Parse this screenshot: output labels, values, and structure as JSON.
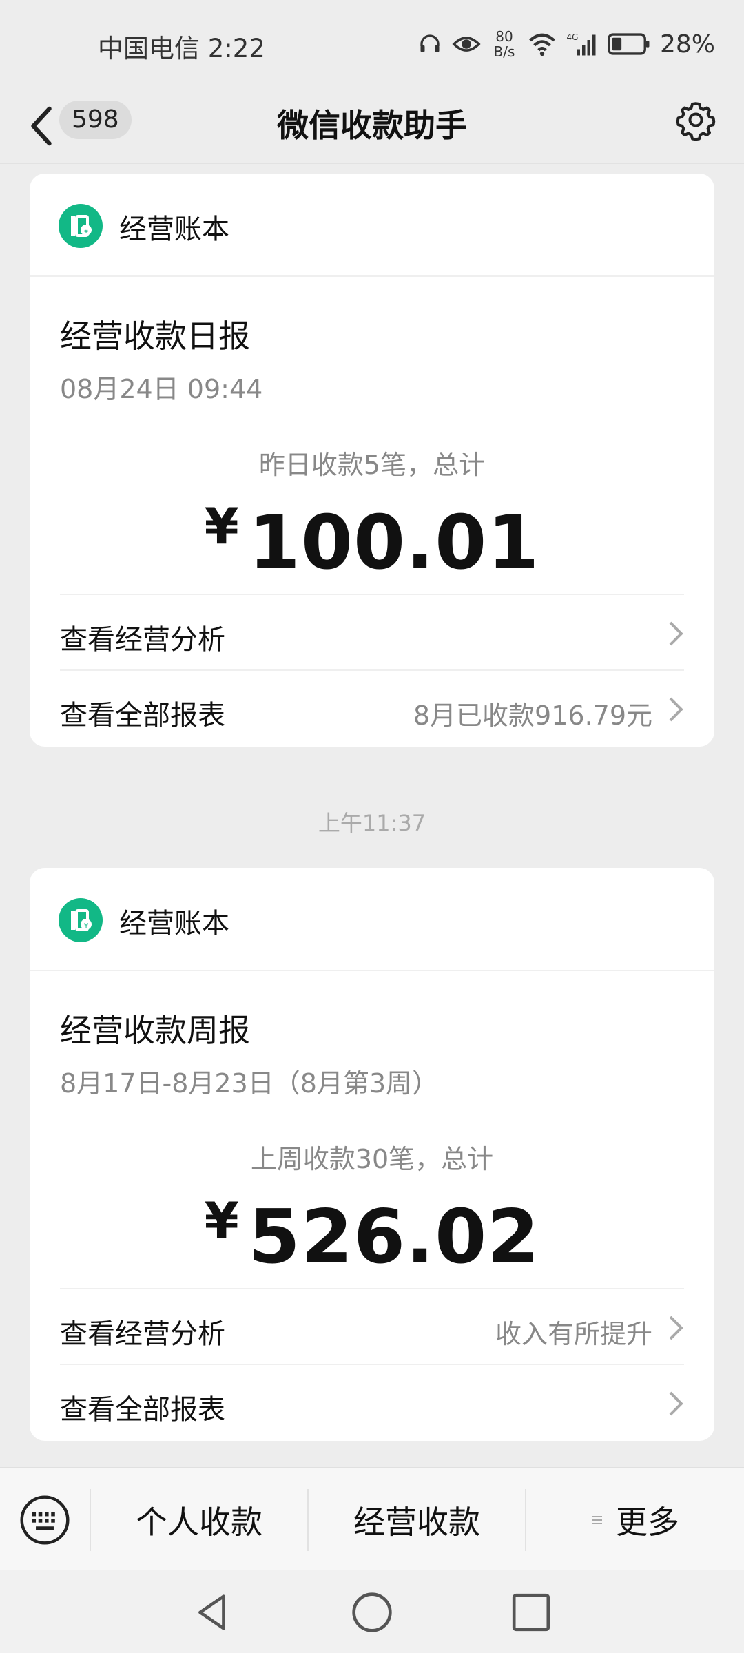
{
  "status_bar": {
    "carrier_time": "中国电信 2:22",
    "speed_value": "80",
    "speed_unit": "B/s",
    "network": "4G",
    "battery_percent": "28%"
  },
  "header": {
    "unread_count": "598",
    "title": "微信收款助手"
  },
  "cards": [
    {
      "app_name": "经营账本",
      "report_title": "经营收款日报",
      "report_date": "08月24日 09:44",
      "summary": "昨日收款5笔，总计",
      "currency": "¥",
      "amount": "100.01",
      "rows": [
        {
          "label": "查看经营分析",
          "value": ""
        },
        {
          "label": "查看全部报表",
          "value": "8月已收款916.79元"
        }
      ]
    },
    {
      "app_name": "经营账本",
      "report_title": "经营收款周报",
      "report_date": "8月17日-8月23日（8月第3周）",
      "summary": "上周收款30笔，总计",
      "currency": "¥",
      "amount": "526.02",
      "rows": [
        {
          "label": "查看经营分析",
          "value": "收入有所提升"
        },
        {
          "label": "查看全部报表",
          "value": ""
        }
      ]
    }
  ],
  "time_separator": "上午11:37",
  "bottom_menu": {
    "personal": "个人收款",
    "business": "经营收款",
    "more": "更多"
  },
  "colors": {
    "accent_green": "#12b886",
    "background": "#ededed"
  }
}
